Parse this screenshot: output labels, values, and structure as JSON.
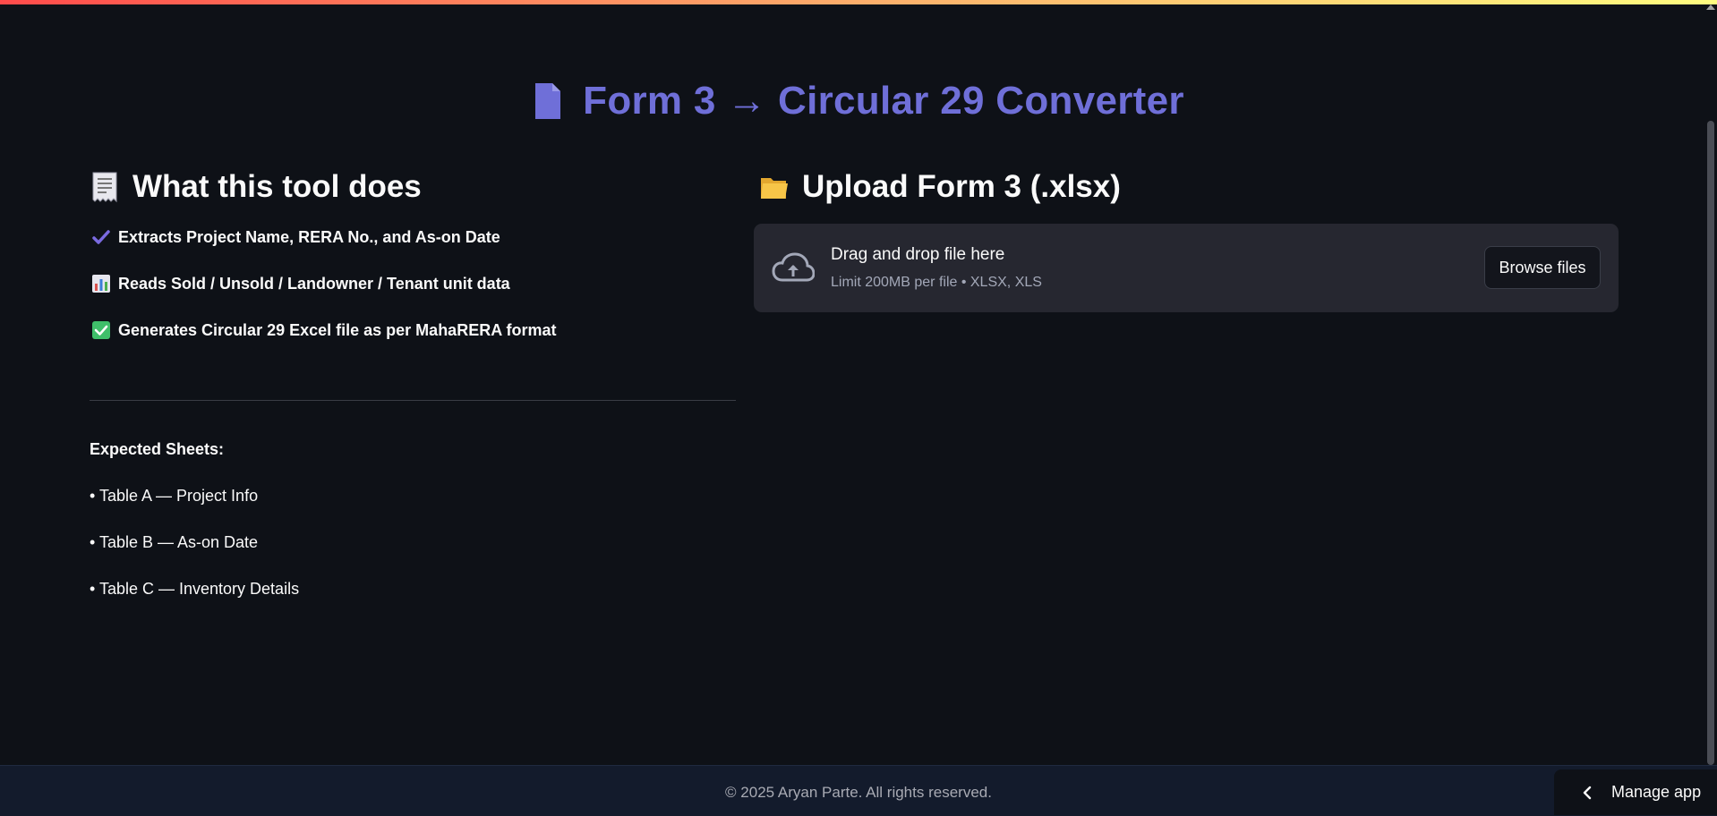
{
  "page": {
    "title": "Form 3 → Circular 29 Converter"
  },
  "left": {
    "heading": "What this tool does",
    "features": [
      "Extracts Project Name, RERA No., and As-on Date",
      "Reads Sold / Unsold / Landowner / Tenant unit data",
      "Generates Circular 29 Excel file as per MahaRERA format"
    ],
    "expected_label": "Expected Sheets:",
    "expected_items": [
      "• Table A — Project Info",
      "• Table B — As-on Date",
      "• Table C — Inventory Details"
    ]
  },
  "upload": {
    "heading": "Upload Form 3 (.xlsx)",
    "drop_text": "Drag and drop file here",
    "limit_text": "Limit 200MB per file • XLSX, XLS",
    "browse_label": "Browse files"
  },
  "footer": {
    "copyright": "© 2025 Aryan Parte. All rights reserved."
  },
  "manage": {
    "label": "Manage app"
  },
  "icons": {
    "title": "document-icon",
    "left_heading": "receipt-icon",
    "features": [
      "check-mark-icon",
      "bar-chart-icon",
      "check-box-icon"
    ],
    "upload_heading": "folder-icon",
    "dropzone": "cloud-upload-icon",
    "manage": "chevron-left-icon"
  },
  "colors": {
    "background": "#0e1117",
    "title": "#6f6fd8",
    "dropzone": "#262730",
    "footer": "#131b2c"
  }
}
